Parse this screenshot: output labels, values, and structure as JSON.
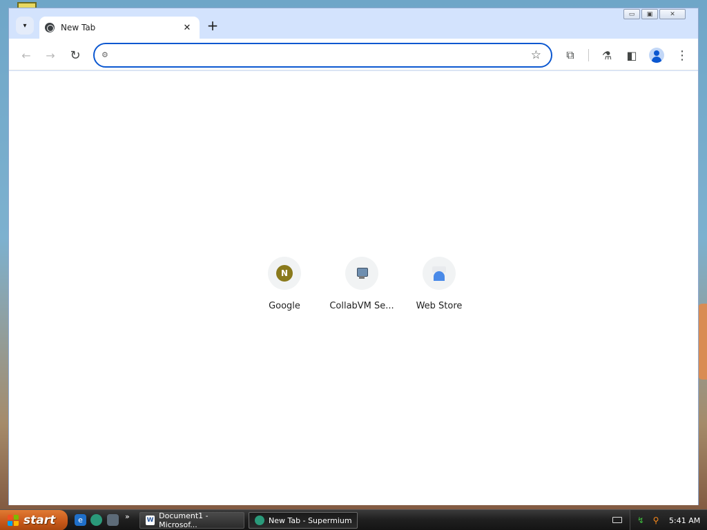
{
  "browser": {
    "tab": {
      "title": "New Tab",
      "close_glyph": "✕"
    },
    "new_tab_glyph": "+",
    "tab_search_glyph": "▾",
    "window_controls": {
      "minimize": "▭",
      "restore": "▣",
      "close": "✕"
    },
    "toolbar": {
      "back_glyph": "←",
      "forward_glyph": "→",
      "reload_glyph": "↻",
      "bookmark_glyph": "☆",
      "extensions_glyph": "⧉",
      "labs_glyph": "⚗",
      "side_panel_glyph": "◧",
      "menu_glyph": "⋮"
    },
    "omnibox": {
      "value": "",
      "placeholder": ""
    }
  },
  "new_tab_page": {
    "shortcuts": [
      {
        "label": "Google",
        "icon": "n-letter-icon"
      },
      {
        "label": "CollabVM Se...",
        "icon": "computer-icon"
      },
      {
        "label": "Web Store",
        "icon": "web-store-icon"
      }
    ]
  },
  "taskbar": {
    "start_label": "start",
    "quick_launch_more": "»",
    "tasks": [
      {
        "label": "Document1 - Microsof...",
        "icon": "word-icon"
      },
      {
        "label": "New Tab - Supermium",
        "icon": "supermium-icon"
      }
    ],
    "clock": "5:41 AM"
  },
  "colors": {
    "accent": "#0b57d0",
    "tab_strip": "#d3e3fd",
    "start_button": "#c8591a",
    "taskbar": "#1f1f1f"
  }
}
